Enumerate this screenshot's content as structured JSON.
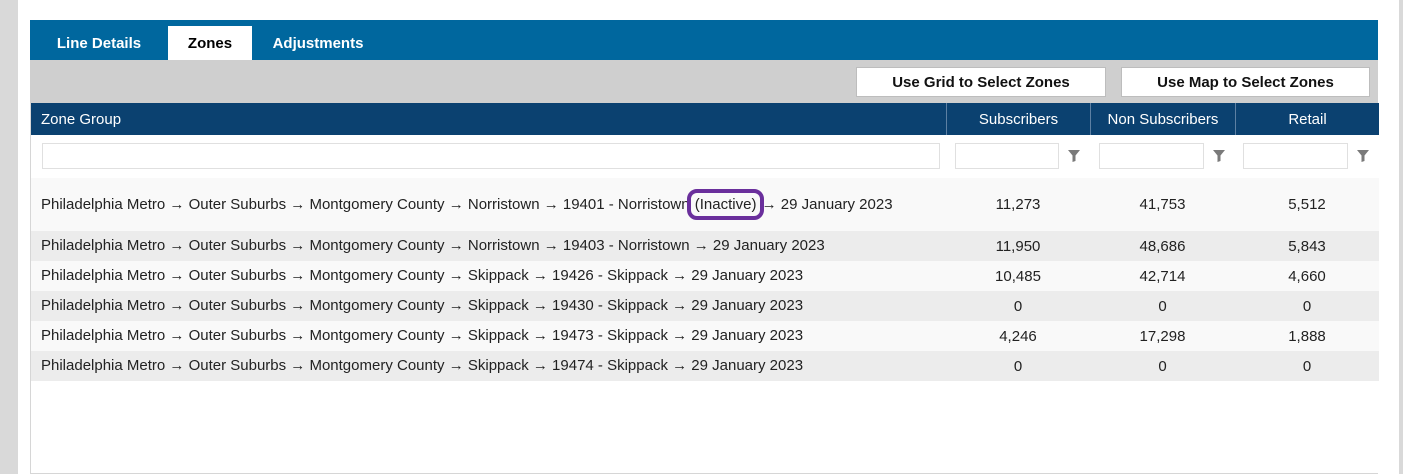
{
  "tabs": [
    {
      "label": "Line Details",
      "active": false
    },
    {
      "label": "Zones",
      "active": true
    },
    {
      "label": "Adjustments",
      "active": false
    }
  ],
  "toolbar": {
    "grid_button": "Use Grid to Select Zones",
    "map_button": "Use Map to Select Zones"
  },
  "grid": {
    "columns": [
      "Zone Group",
      "Subscribers",
      "Non Subscribers",
      "Retail"
    ],
    "filters": {
      "zone_group": "",
      "subscribers": "",
      "non_subscribers": "",
      "retail": ""
    },
    "rows": [
      {
        "zone_pre": "Philadelphia Metro → Outer Suburbs → Montgomery County → Norristown → 19401 - Norristown ",
        "zone_tag": "(Inactive)",
        "zone_post": " → 29 January 2023",
        "subscribers": "11,273",
        "non_subscribers": "41,753",
        "retail": "5,512"
      },
      {
        "zone_pre": "Philadelphia Metro → Outer Suburbs → Montgomery County → Norristown → 19403 - Norristown → 29 January 2023",
        "zone_tag": "",
        "zone_post": "",
        "subscribers": "11,950",
        "non_subscribers": "48,686",
        "retail": "5,843"
      },
      {
        "zone_pre": "Philadelphia Metro → Outer Suburbs → Montgomery County → Skippack → 19426 - Skippack → 29 January 2023",
        "zone_tag": "",
        "zone_post": "",
        "subscribers": "10,485",
        "non_subscribers": "42,714",
        "retail": "4,660"
      },
      {
        "zone_pre": "Philadelphia Metro → Outer Suburbs → Montgomery County → Skippack → 19430 - Skippack → 29 January 2023",
        "zone_tag": "",
        "zone_post": "",
        "subscribers": "0",
        "non_subscribers": "0",
        "retail": "0"
      },
      {
        "zone_pre": "Philadelphia Metro → Outer Suburbs → Montgomery County → Skippack → 19473 - Skippack → 29 January 2023",
        "zone_tag": "",
        "zone_post": "",
        "subscribers": "4,246",
        "non_subscribers": "17,298",
        "retail": "1,888"
      },
      {
        "zone_pre": "Philadelphia Metro → Outer Suburbs → Montgomery County → Skippack → 19474 - Skippack → 29 January 2023",
        "zone_tag": "",
        "zone_post": "",
        "subscribers": "0",
        "non_subscribers": "0",
        "retail": "0"
      }
    ]
  },
  "icons": {
    "filter": "filter-funnel-icon"
  },
  "colors": {
    "tab_bar": "#00679e",
    "header": "#0b4170",
    "highlight": "#6a2f9c"
  }
}
